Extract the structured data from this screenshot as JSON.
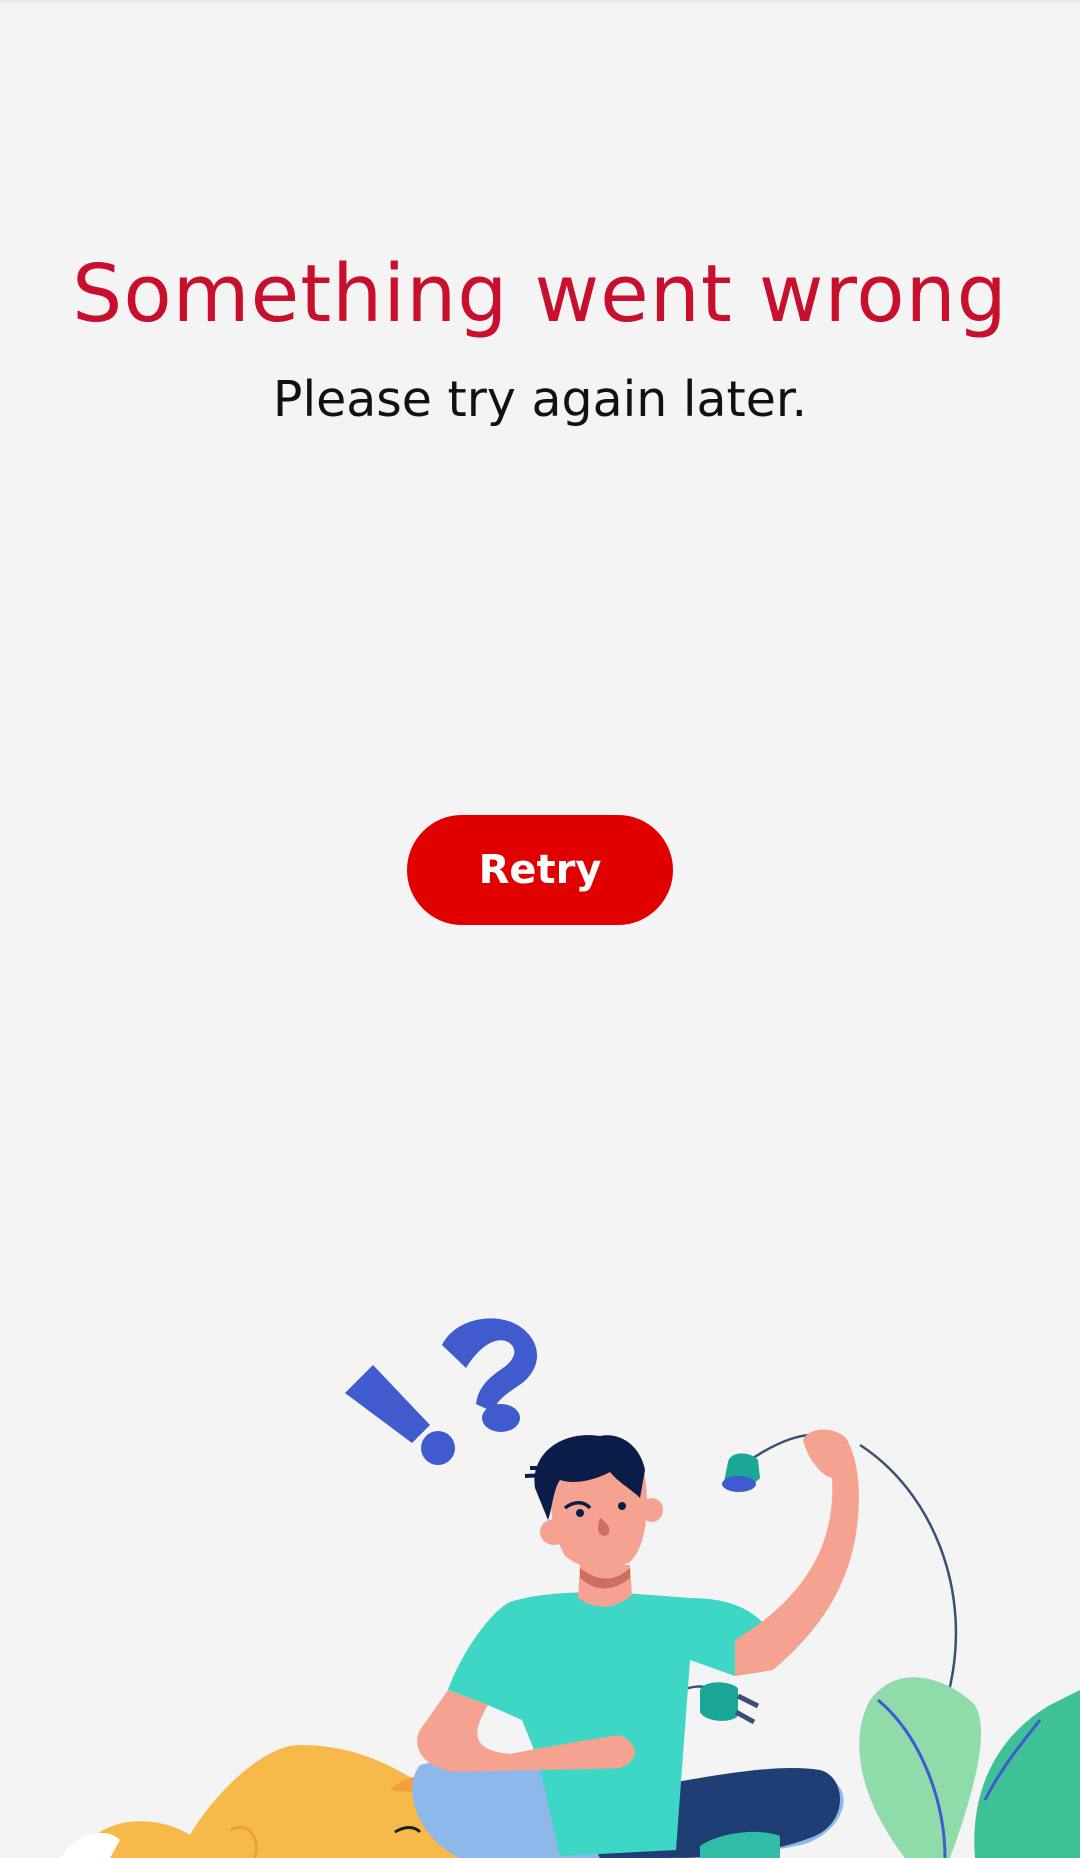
{
  "error": {
    "title": "Something went wrong",
    "subtitle": "Please try again later."
  },
  "actions": {
    "retry_label": "Retry"
  },
  "theme": {
    "title_color": "#c8102e",
    "button_color": "#e00000",
    "background": "#f4f4f4"
  },
  "illustration": {
    "name": "confused-person-unplugged-cable"
  }
}
